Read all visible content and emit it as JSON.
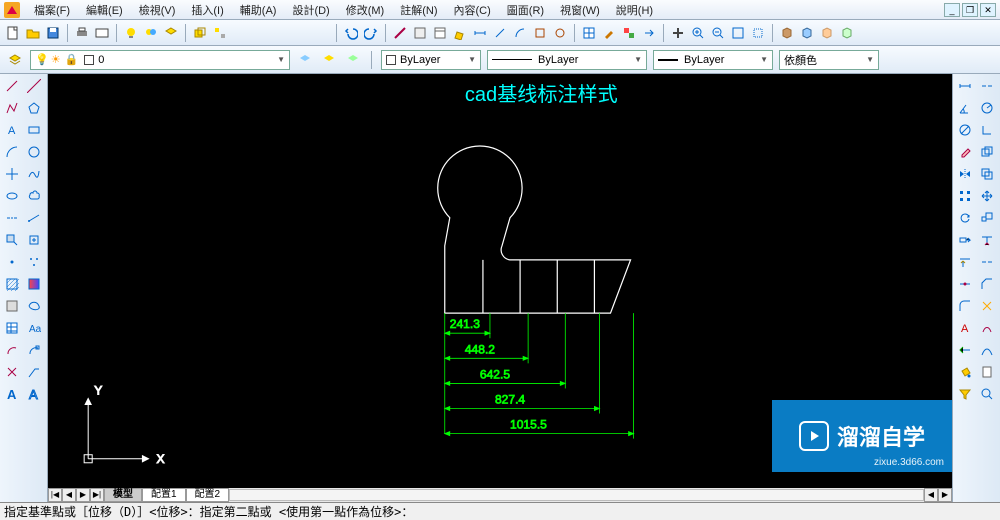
{
  "app": {
    "icon": "app-logo"
  },
  "menu": {
    "file": "檔案(F)",
    "edit": "編輯(E)",
    "view": "檢視(V)",
    "insert": "插入(I)",
    "assist": "輔助(A)",
    "design": "設計(D)",
    "modify": "修改(M)",
    "annotate": "註解(N)",
    "content": "內容(C)",
    "image": "圖面(R)",
    "viewwin": "視窗(W)",
    "help": "說明(H)"
  },
  "layerbar": {
    "layer_value": "0",
    "linetype_label": "ByLayer",
    "lineweight_label": "ByLayer",
    "lineweight2_label": "ByLayer",
    "colorstyle_label": "依顏色"
  },
  "canvas": {
    "title": "cad基线标注样式",
    "title_color": "#00ffff",
    "axis": {
      "x_label": "X",
      "y_label": "Y"
    },
    "dims": {
      "d1": "241.3",
      "d2": "448.2",
      "d3": "642.5",
      "d4": "827.4",
      "d5": "1015.5"
    }
  },
  "tabs": {
    "model": "模型",
    "layout1": "配置1",
    "layout2": "配置2"
  },
  "cmd": {
    "prompt": "指定基準點或［位移（D）］<位移>：指定第二點或 <使用第一點作為位移>："
  },
  "watermark": {
    "brand": "溜溜自学",
    "url": "zixue.3d66.com"
  }
}
